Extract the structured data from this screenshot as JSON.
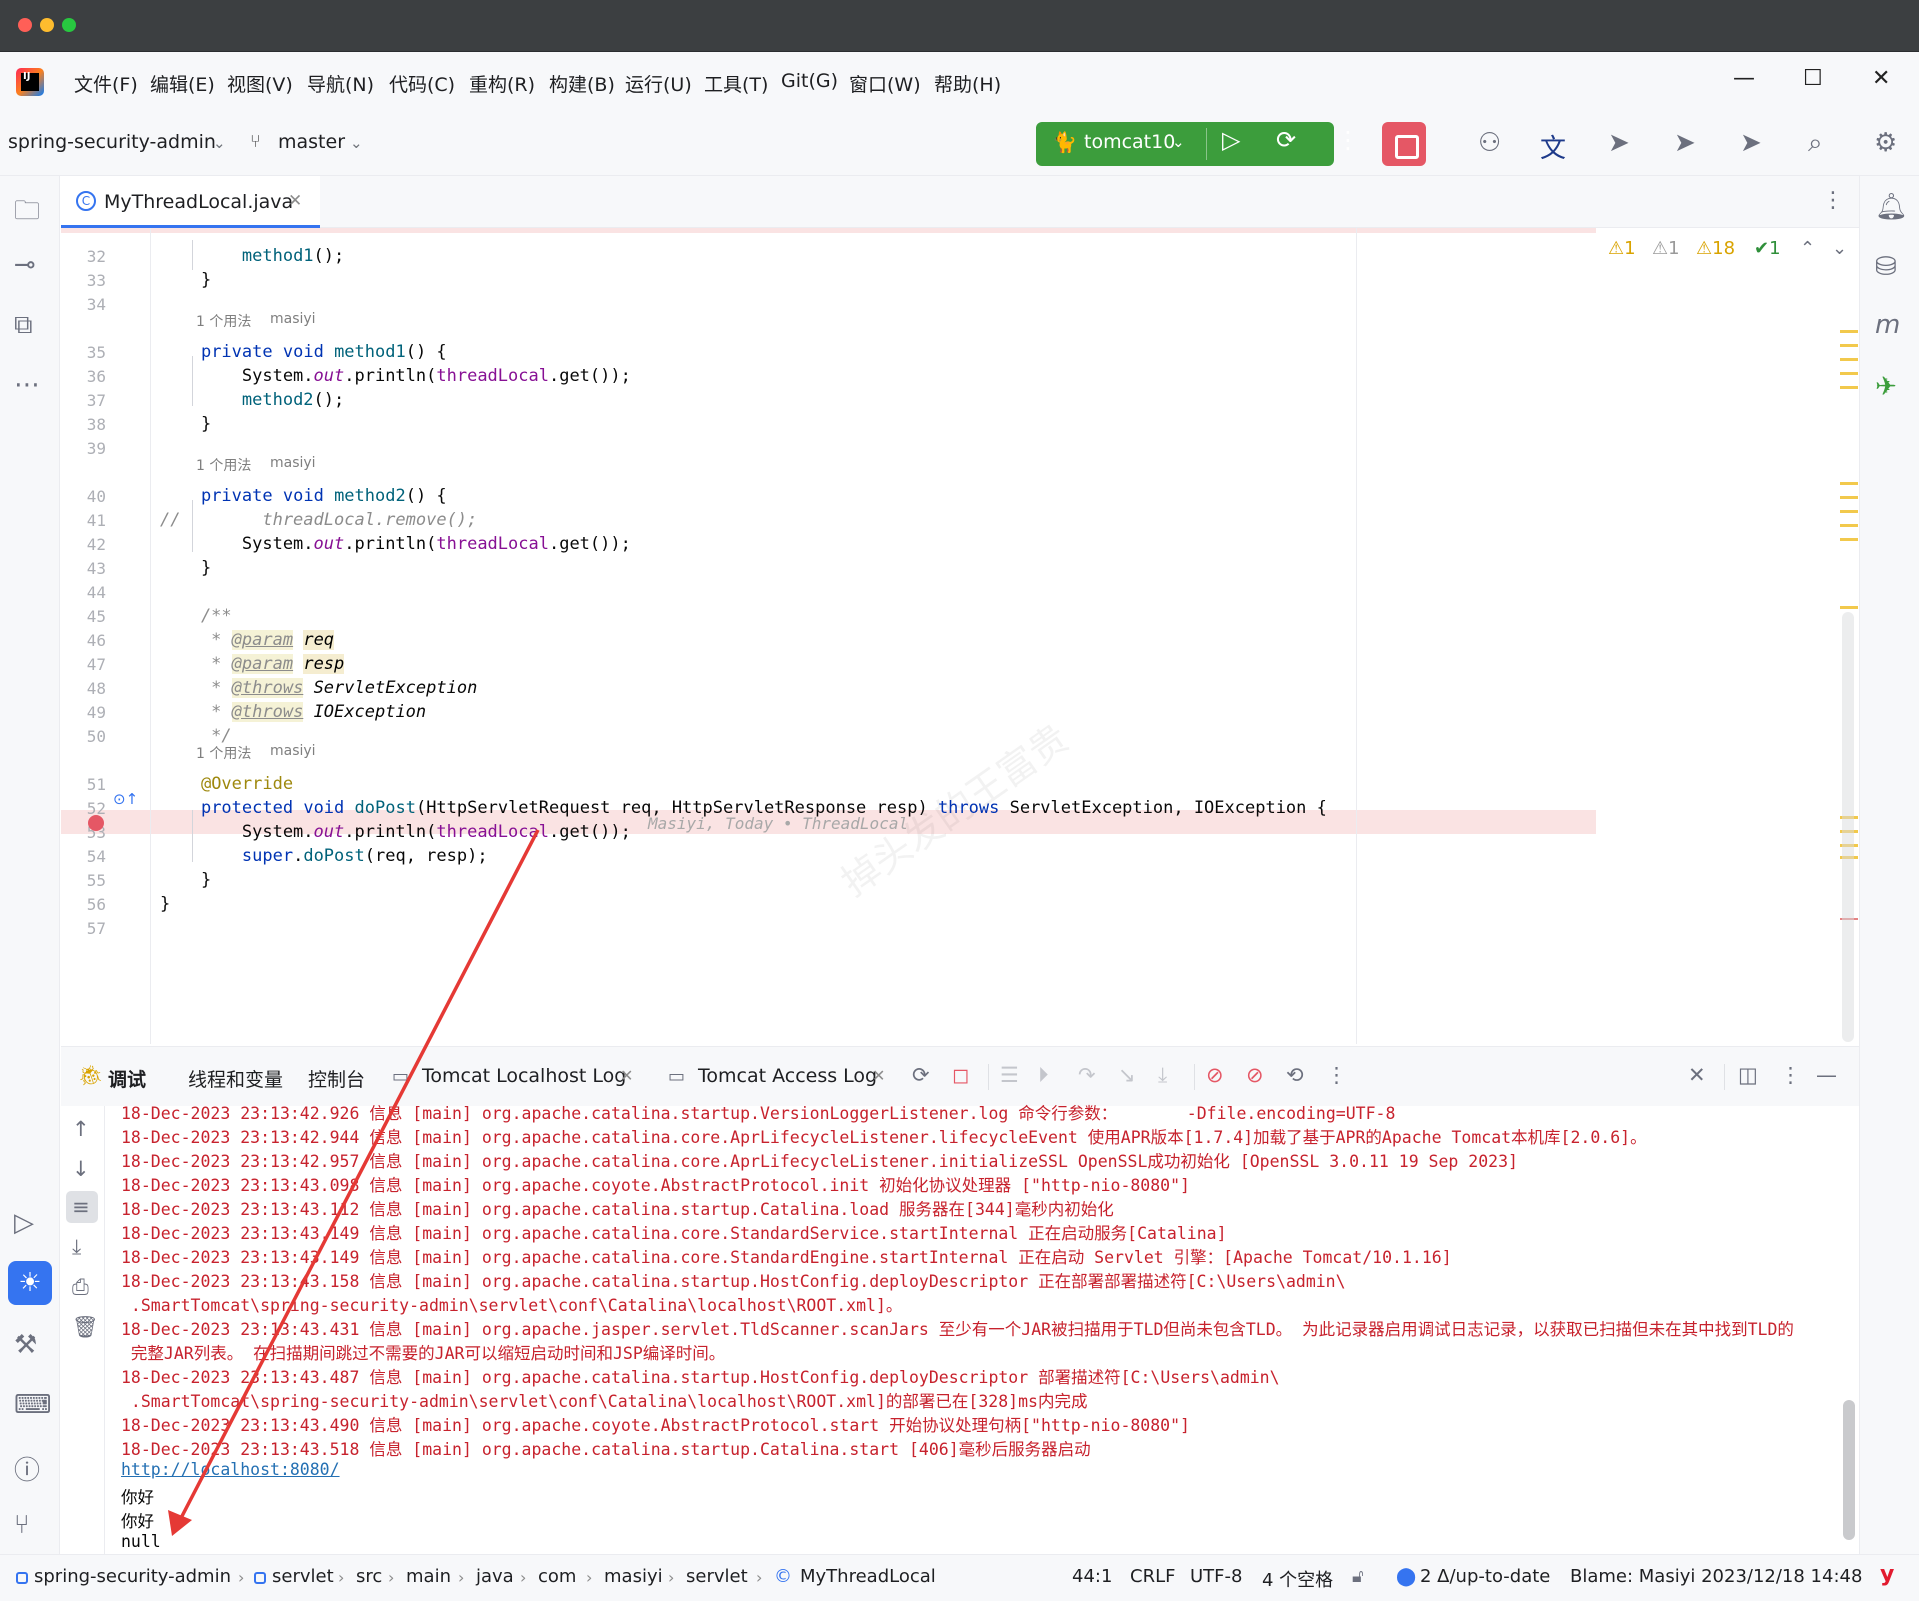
{
  "menu": {
    "items": [
      "文件(F)",
      "编辑(E)",
      "视图(V)",
      "导航(N)",
      "代码(C)",
      "重构(R)",
      "构建(B)",
      "运行(U)",
      "工具(T)",
      "Git(G)",
      "窗口(W)",
      "帮助(H)"
    ]
  },
  "toolbar": {
    "project": "spring-security-admin",
    "branch": "master",
    "run_config": "tomcat10"
  },
  "editor": {
    "tab_label": "MyThreadLocal.java",
    "inspections": {
      "warnings_a": "1",
      "warnings_b": "1",
      "warnings_c": "18",
      "ok": "1"
    },
    "usage_hint": "1 个用法",
    "author_hint": "masiyi",
    "inlay_blame": "Masiyi, Today • ThreadLocal",
    "watermark": "掉头发的王富贵",
    "lines": [
      {
        "n": "32",
        "text": "        method1();"
      },
      {
        "n": "33",
        "text": "    }"
      },
      {
        "n": "34",
        "text": ""
      },
      {
        "n": "35",
        "text": "    private void method1() {"
      },
      {
        "n": "36",
        "text": "        System.out.println(threadLocal.get());"
      },
      {
        "n": "37",
        "text": "        method2();"
      },
      {
        "n": "38",
        "text": "    }"
      },
      {
        "n": "39",
        "text": ""
      },
      {
        "n": "40",
        "text": "    private void method2() {"
      },
      {
        "n": "41",
        "text": "//        threadLocal.remove();"
      },
      {
        "n": "42",
        "text": "        System.out.println(threadLocal.get());"
      },
      {
        "n": "43",
        "text": "    }"
      },
      {
        "n": "44",
        "text": ""
      },
      {
        "n": "45",
        "text": "    /**"
      },
      {
        "n": "46",
        "text": "     * @param req"
      },
      {
        "n": "47",
        "text": "     * @param resp"
      },
      {
        "n": "48",
        "text": "     * @throws ServletException"
      },
      {
        "n": "49",
        "text": "     * @throws IOException"
      },
      {
        "n": "50",
        "text": "     */"
      },
      {
        "n": "51",
        "text": "    @Override"
      },
      {
        "n": "52",
        "text": "    protected void doPost(HttpServletRequest req, HttpServletResponse resp) throws ServletException, IOException {"
      },
      {
        "n": "53",
        "text": "        System.out.println(threadLocal.get());"
      },
      {
        "n": "54",
        "text": "        super.doPost(req, resp);"
      },
      {
        "n": "55",
        "text": "    }"
      },
      {
        "n": "56",
        "text": "}"
      },
      {
        "n": "57",
        "text": ""
      }
    ]
  },
  "debug": {
    "title": "调试",
    "tabs": [
      "线程和变量",
      "控制台",
      "Tomcat Localhost Log",
      "Tomcat Access Log"
    ],
    "console": [
      {
        "cls": "",
        "text": "18-Dec-2023 23:13:42.926 信息 [main] org.apache.catalina.startup.VersionLoggerListener.log 命令行参数：       -Dfile.encoding=UTF-8"
      },
      {
        "cls": "",
        "text": "18-Dec-2023 23:13:42.944 信息 [main] org.apache.catalina.core.AprLifecycleListener.lifecycleEvent 使用APR版本[1.7.4]加载了基于APR的Apache Tomcat本机库[2.0.6]。"
      },
      {
        "cls": "",
        "text": "18-Dec-2023 23:13:42.957 信息 [main] org.apache.catalina.core.AprLifecycleListener.initializeSSL OpenSSL成功初始化 [OpenSSL 3.0.11 19 Sep 2023]"
      },
      {
        "cls": "",
        "text": "18-Dec-2023 23:13:43.098 信息 [main] org.apache.coyote.AbstractProtocol.init 初始化协议处理器 [\"http-nio-8080\"]"
      },
      {
        "cls": "",
        "text": "18-Dec-2023 23:13:43.112 信息 [main] org.apache.catalina.startup.Catalina.load 服务器在[344]毫秒内初始化"
      },
      {
        "cls": "",
        "text": "18-Dec-2023 23:13:43.149 信息 [main] org.apache.catalina.core.StandardService.startInternal 正在启动服务[Catalina]"
      },
      {
        "cls": "",
        "text": "18-Dec-2023 23:13:43.149 信息 [main] org.apache.catalina.core.StandardEngine.startInternal 正在启动 Servlet 引擎：[Apache Tomcat/10.1.16]"
      },
      {
        "cls": "",
        "text": "18-Dec-2023 23:13:43.158 信息 [main] org.apache.catalina.startup.HostConfig.deployDescriptor 正在部署部署描述符[C:\\Users\\admin\\"
      },
      {
        "cls": "",
        "text": " .SmartTomcat\\spring-security-admin\\servlet\\conf\\Catalina\\localhost\\ROOT.xml]。"
      },
      {
        "cls": "",
        "text": "18-Dec-2023 23:13:43.431 信息 [main] org.apache.jasper.servlet.TldScanner.scanJars 至少有一个JAR被扫描用于TLD但尚未包含TLD。 为此记录器启用调试日志记录，以获取已扫描但未在其中找到TLD的"
      },
      {
        "cls": "",
        "text": " 完整JAR列表。 在扫描期间跳过不需要的JAR可以缩短启动时间和JSP编译时间。"
      },
      {
        "cls": "",
        "text": "18-Dec-2023 23:13:43.487 信息 [main] org.apache.catalina.startup.HostConfig.deployDescriptor 部署描述符[C:\\Users\\admin\\"
      },
      {
        "cls": "",
        "text": " .SmartTomcat\\spring-security-admin\\servlet\\conf\\Catalina\\localhost\\ROOT.xml]的部署已在[328]ms内完成"
      },
      {
        "cls": "",
        "text": "18-Dec-2023 23:13:43.490 信息 [main] org.apache.coyote.AbstractProtocol.start 开始协议处理句柄[\"http-nio-8080\"]"
      },
      {
        "cls": "",
        "text": "18-Dec-2023 23:13:43.518 信息 [main] org.apache.catalina.startup.Catalina.start [406]毫秒后服务器启动"
      },
      {
        "cls": "link",
        "text": "http://localhost:8080/"
      },
      {
        "cls": "norm",
        "text": "你好"
      },
      {
        "cls": "norm",
        "text": "你好"
      },
      {
        "cls": "norm",
        "text": "null"
      }
    ]
  },
  "status": {
    "breadcrumb": [
      "spring-security-admin",
      "servlet",
      "src",
      "main",
      "java",
      "com",
      "masiyi",
      "servlet",
      "MyThreadLocal"
    ],
    "position": "44:1",
    "line_sep": "CRLF",
    "encoding": "UTF-8",
    "indent": "4 个空格",
    "vcs": "2 Δ/up-to-date",
    "blame": "Blame: Masiyi 2023/12/18 14:48"
  },
  "colors": {
    "accent": "#3574f0",
    "run_green": "#3c9d3c",
    "stop_red": "#e55765",
    "console_error": "#c7222d",
    "arrow": "#e53935"
  }
}
